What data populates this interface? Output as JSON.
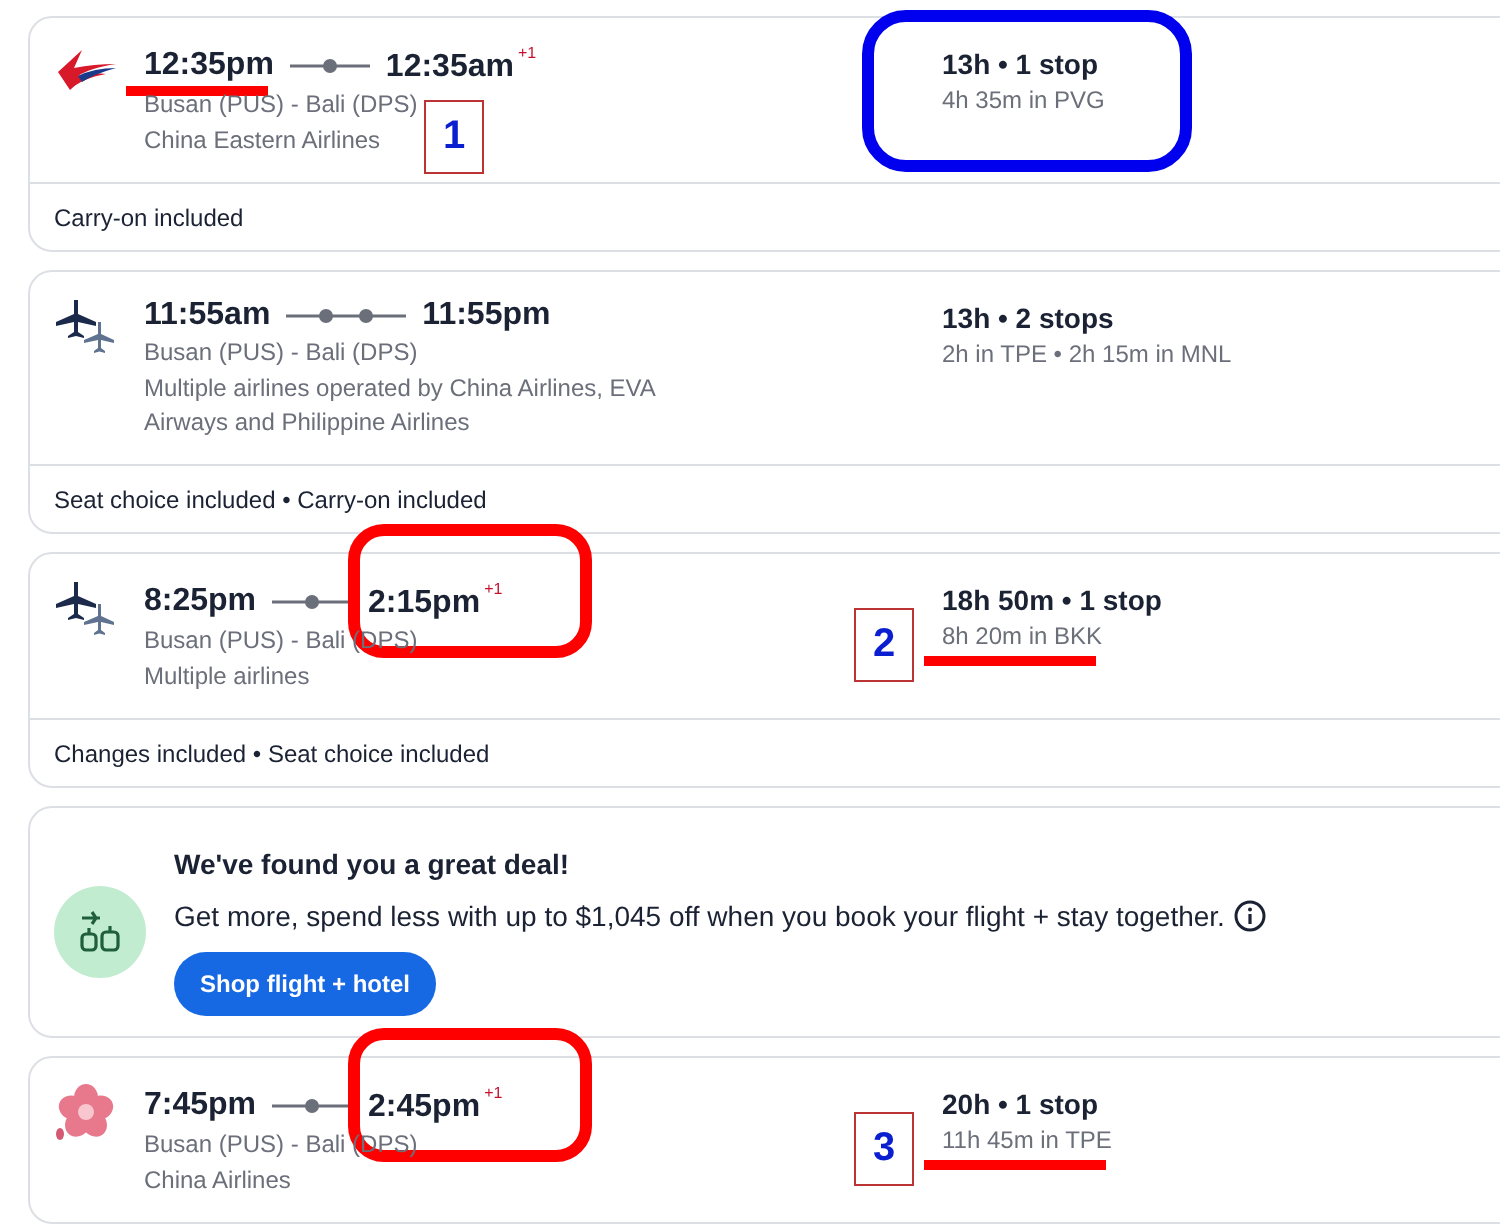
{
  "flights": [
    {
      "logo": {
        "kind": "swoosh"
      },
      "depart": "12:35pm",
      "timeline": [
        {
          "kind": "dot"
        }
      ],
      "arrive": "12:35am",
      "arrive_offset": "+1",
      "route": "Busan (PUS) - Bali (DPS)",
      "airline": "China Eastern Airlines",
      "duration": "13h • 1 stop",
      "layover": "4h 35m in PVG",
      "footer": "Carry-on included",
      "depart_marks": [
        {
          "kind": "underline",
          "color": "#ff0000"
        }
      ],
      "route_marks": [
        {
          "kind": "tag",
          "label": "1"
        }
      ],
      "stops_marks": [
        {
          "kind": "ring",
          "color": "#0000ee"
        }
      ]
    },
    {
      "logo": {
        "kind": "planes"
      },
      "depart": "11:55am",
      "timeline": [
        {
          "kind": "dot"
        },
        {
          "kind": "dot"
        }
      ],
      "arrive": "11:55pm",
      "route": "Busan (PUS) - Bali (DPS)",
      "airline": "Multiple airlines operated by China Airlines, EVA Airways and Philippine Airlines",
      "duration": "13h • 2 stops",
      "layover": "2h in TPE • 2h 15m in MNL",
      "footer": "Seat choice included • Carry-on included"
    },
    {
      "logo": {
        "kind": "planes"
      },
      "depart": "8:25pm",
      "timeline": [
        {
          "kind": "dot"
        }
      ],
      "arrive": "2:15pm",
      "arrive_offset": "+1",
      "route": "Busan (PUS) - Bali (DPS)",
      "airline": "Multiple airlines",
      "duration": "18h 50m • 1 stop",
      "layover": "8h 20m in BKK",
      "footer": "Changes included • Seat choice included",
      "arrive_marks": [
        {
          "kind": "ring",
          "color": "#ff0000"
        }
      ],
      "stops_marks": [
        {
          "kind": "tag",
          "label": "2"
        }
      ],
      "layover_marks": [
        {
          "kind": "underline",
          "color": "#ff0000"
        }
      ]
    },
    {
      "kind": "deal",
      "title": "We've found you a great deal!",
      "text": "Get more, spend less with up to $1,045 off when you book your flight + stay together.",
      "button": "Shop flight + hotel"
    },
    {
      "logo": {
        "kind": "flower"
      },
      "depart": "7:45pm",
      "timeline": [
        {
          "kind": "dot"
        }
      ],
      "arrive": "2:45pm",
      "arrive_offset": "+1",
      "route": "Busan (PUS) - Bali (DPS)",
      "airline": "China Airlines",
      "duration": "20h • 1 stop",
      "layover": "11h 45m in TPE",
      "arrive_marks": [
        {
          "kind": "ring",
          "color": "#ff0000"
        }
      ],
      "stops_marks": [
        {
          "kind": "tag",
          "label": "3"
        }
      ],
      "layover_marks": [
        {
          "kind": "underline",
          "color": "#ff0000"
        }
      ]
    }
  ]
}
